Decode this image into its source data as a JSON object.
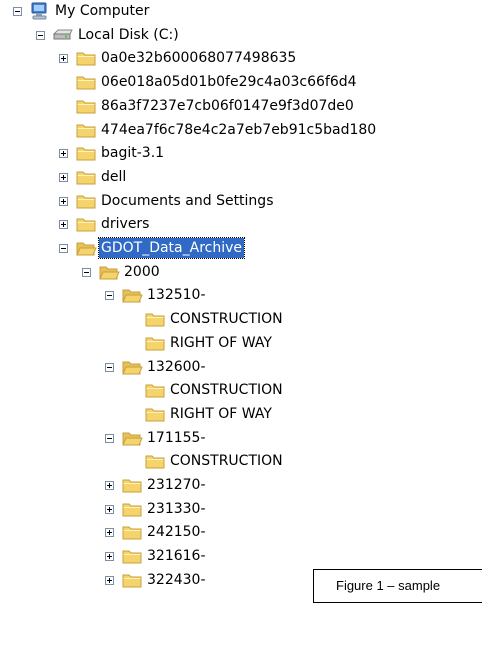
{
  "tree": {
    "nodes": [
      {
        "label": "My Computer",
        "depth": 0,
        "icon": "computer-icon",
        "toggle": "minus"
      },
      {
        "label": "Local Disk (C:)",
        "depth": 1,
        "icon": "drive-icon",
        "toggle": "minus"
      },
      {
        "label": "0a0e32b600068077498635",
        "depth": 2,
        "icon": "folder-icon",
        "toggle": "plus"
      },
      {
        "label": "06e018a05d01b0fe29c4a03c66f6d4",
        "depth": 2,
        "icon": "folder-icon",
        "toggle": "none"
      },
      {
        "label": "86a3f7237e7cb06f0147e9f3d07de0",
        "depth": 2,
        "icon": "folder-icon",
        "toggle": "none"
      },
      {
        "label": "474ea7f6c78e4c2a7eb7eb91c5bad180",
        "depth": 2,
        "icon": "folder-icon",
        "toggle": "none"
      },
      {
        "label": "bagit-3.1",
        "depth": 2,
        "icon": "folder-icon",
        "toggle": "plus"
      },
      {
        "label": "dell",
        "depth": 2,
        "icon": "folder-icon",
        "toggle": "plus"
      },
      {
        "label": "Documents and Settings",
        "depth": 2,
        "icon": "folder-icon",
        "toggle": "plus"
      },
      {
        "label": "drivers",
        "depth": 2,
        "icon": "folder-icon",
        "toggle": "plus"
      },
      {
        "label": "GDOT_Data_Archive",
        "depth": 2,
        "icon": "open-folder-icon",
        "toggle": "minus",
        "selected": true
      },
      {
        "label": "2000",
        "depth": 3,
        "icon": "open-folder-icon",
        "toggle": "minus"
      },
      {
        "label": "132510-",
        "depth": 4,
        "icon": "open-folder-icon",
        "toggle": "minus"
      },
      {
        "label": "CONSTRUCTION",
        "depth": 5,
        "icon": "folder-icon",
        "toggle": "none"
      },
      {
        "label": "RIGHT OF WAY",
        "depth": 5,
        "icon": "folder-icon",
        "toggle": "none"
      },
      {
        "label": "132600-",
        "depth": 4,
        "icon": "open-folder-icon",
        "toggle": "minus"
      },
      {
        "label": "CONSTRUCTION",
        "depth": 5,
        "icon": "folder-icon",
        "toggle": "none"
      },
      {
        "label": "RIGHT OF WAY",
        "depth": 5,
        "icon": "folder-icon",
        "toggle": "none"
      },
      {
        "label": "171155-",
        "depth": 4,
        "icon": "open-folder-icon",
        "toggle": "minus"
      },
      {
        "label": "CONSTRUCTION",
        "depth": 5,
        "icon": "folder-icon",
        "toggle": "none"
      },
      {
        "label": "231270-",
        "depth": 4,
        "icon": "folder-icon",
        "toggle": "plus"
      },
      {
        "label": "231330-",
        "depth": 4,
        "icon": "folder-icon",
        "toggle": "plus"
      },
      {
        "label": "242150-",
        "depth": 4,
        "icon": "folder-icon",
        "toggle": "plus"
      },
      {
        "label": "321616-",
        "depth": 4,
        "icon": "folder-icon",
        "toggle": "plus"
      },
      {
        "label": "322430-",
        "depth": 4,
        "icon": "folder-icon",
        "toggle": "plus"
      }
    ]
  },
  "caption": {
    "text": "Figure 1 – sample"
  },
  "colors": {
    "folder": "#f5d46e",
    "folder_edge": "#c9a03a",
    "selection": "#316ac5",
    "toggle_border": "#7a8ea8"
  }
}
